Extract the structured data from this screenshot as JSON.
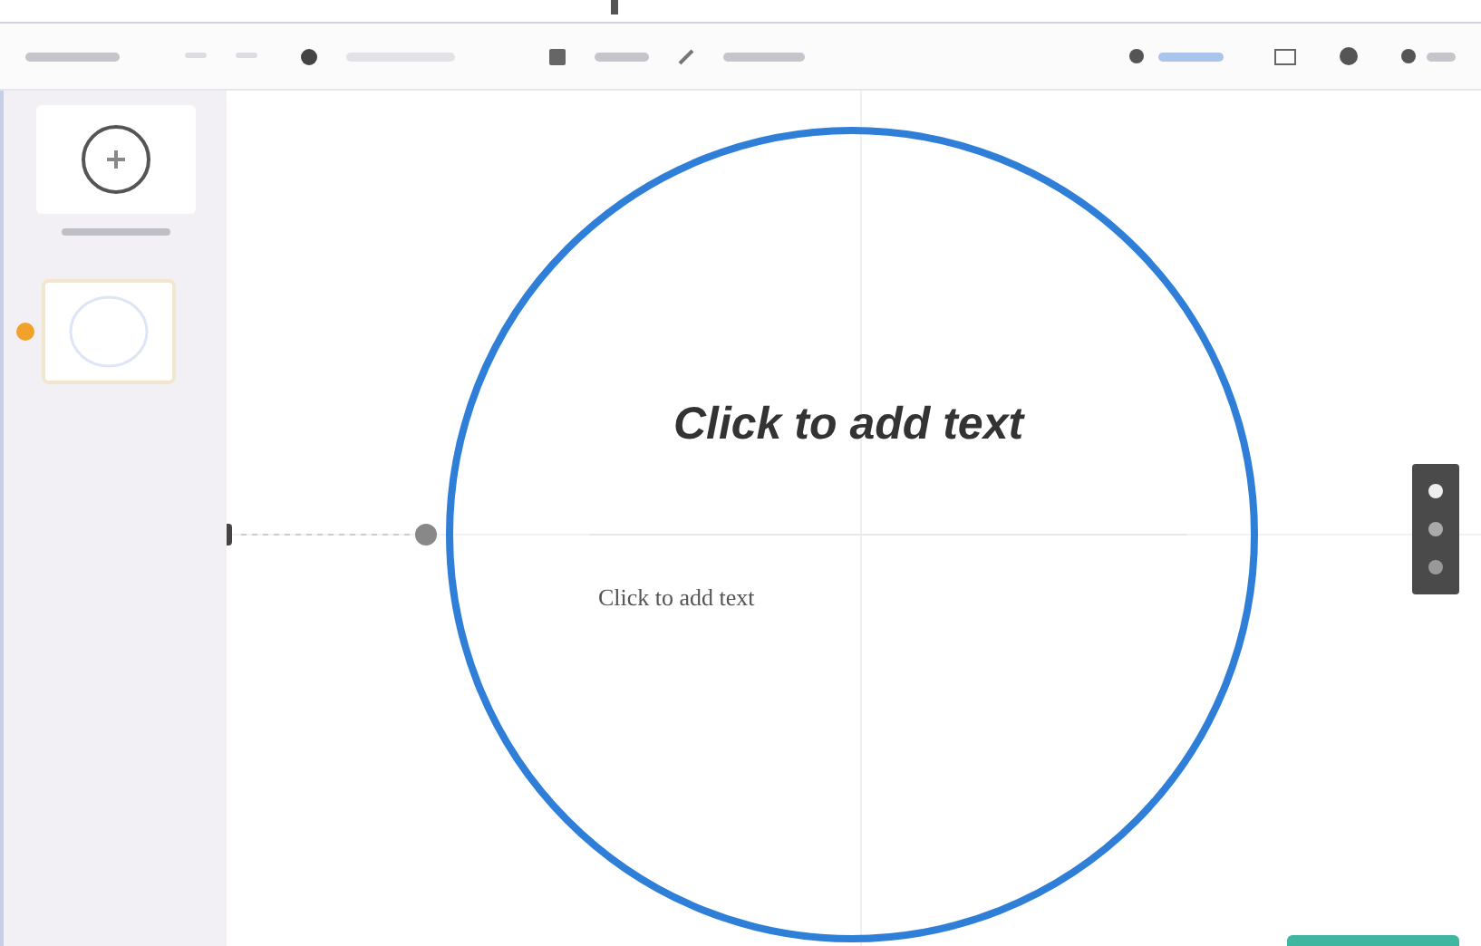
{
  "canvas": {
    "title": "Click to add text",
    "body": "Click to add text"
  }
}
